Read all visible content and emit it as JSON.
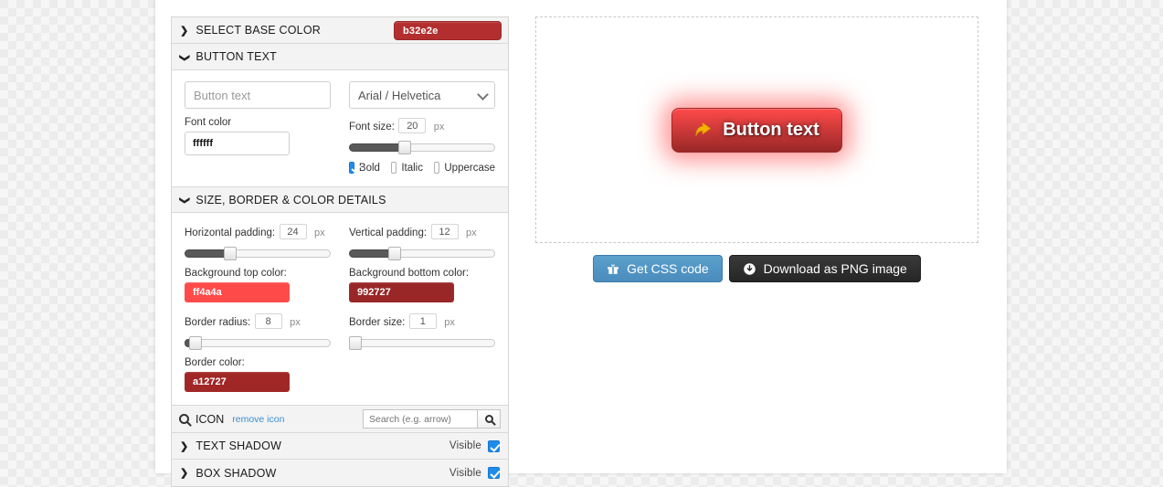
{
  "sections": {
    "base_color": {
      "title": "SELECT BASE COLOR",
      "caret": "chevron-right-icon",
      "value": "b32e2e"
    },
    "button_text": {
      "title": "BUTTON TEXT",
      "caret": "chevron-down-icon",
      "text_value": "Button text",
      "font_family": "Arial / Helvetica",
      "font_color_label": "Font color",
      "font_color_value": "ffffff",
      "font_size_label": "Font size:",
      "font_size_value": "20",
      "font_size_unit": "px",
      "bold_label": "Bold",
      "italic_label": "Italic",
      "uppercase_label": "Uppercase"
    },
    "size_border": {
      "title": "SIZE, BORDER & COLOR DETAILS",
      "caret": "chevron-down-icon",
      "h_padding_label": "Horizontal padding:",
      "h_padding_value": "24",
      "v_padding_label": "Vertical padding:",
      "v_padding_value": "12",
      "bg_top_label": "Background top color:",
      "bg_top_value": "ff4a4a",
      "bg_bottom_label": "Background bottom color:",
      "bg_bottom_value": "992727",
      "border_radius_label": "Border radius:",
      "border_radius_value": "8",
      "border_size_label": "Border size:",
      "border_size_value": "1",
      "border_color_label": "Border color:",
      "border_color_value": "a12727",
      "unit": "px"
    },
    "icon": {
      "title": "ICON",
      "remove_label": "remove icon",
      "search_placeholder": "Search (e.g. arrow)"
    },
    "text_shadow": {
      "title": "TEXT SHADOW",
      "visible_label": "Visible",
      "visible": true
    },
    "box_shadow": {
      "title": "BOX SHADOW",
      "visible_label": "Visible",
      "visible": true
    }
  },
  "preview": {
    "button_label": "Button text",
    "icon": "share-arrow-icon"
  },
  "actions": {
    "css_label": "Get CSS code",
    "png_label": "Download as PNG image"
  }
}
